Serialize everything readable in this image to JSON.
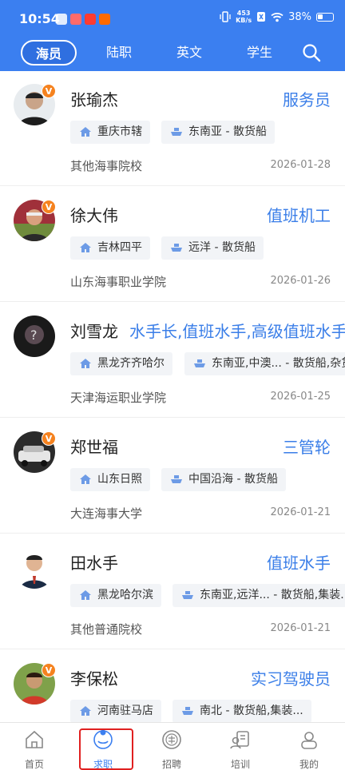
{
  "status_bar": {
    "time": "10:54",
    "net_speed_value": "453",
    "net_speed_unit": "KB/s",
    "battery": "38%"
  },
  "tabs": [
    {
      "label": "海员",
      "active": true
    },
    {
      "label": "陆职",
      "active": false
    },
    {
      "label": "英文",
      "active": false
    },
    {
      "label": "学生",
      "active": false
    }
  ],
  "colors": {
    "header": "#3b7ff0",
    "accent": "#3a7ee8",
    "badge": "#f5821f",
    "highlight_box": "#e02020"
  },
  "candidates": [
    {
      "name": "张瑜杰",
      "position": "服务员",
      "location": "重庆市辖",
      "route": "东南亚 - 散货船",
      "school": "其他海事院校",
      "date": "2026-01-28",
      "verified_badge": "V"
    },
    {
      "name": "徐大伟",
      "position": "值班机工",
      "location": "吉林四平",
      "route": "远洋 - 散货船",
      "school": "山东海事职业学院",
      "date": "2026-01-26",
      "verified_badge": "V"
    },
    {
      "name": "刘雪龙",
      "position": "水手长,值班水手,高级值班水手",
      "location": "黑龙齐齐哈尔",
      "route": "东南亚,中澳... - 散货船,杂货船",
      "school": "天津海运职业学院",
      "date": "2026-01-25",
      "verified_badge": ""
    },
    {
      "name": "郑世福",
      "position": "三管轮",
      "location": "山东日照",
      "route": "中国沿海 - 散货船",
      "school": "大连海事大学",
      "date": "2026-01-21",
      "verified_badge": "V"
    },
    {
      "name": "田水手",
      "position": "值班水手",
      "location": "黑龙哈尔滨",
      "route": "东南亚,远洋... - 散货船,集装...",
      "school": "其他普通院校",
      "date": "2026-01-21",
      "verified_badge": ""
    },
    {
      "name": "李保松",
      "position": "实习驾驶员",
      "location": "河南驻马店",
      "route": "南北 - 散货船,集装...",
      "school": "",
      "date": "",
      "verified_badge": "V"
    }
  ],
  "bottom_nav": [
    {
      "label": "首页",
      "icon": "home-icon",
      "active": false
    },
    {
      "label": "求职",
      "icon": "job-seeker-icon",
      "active": true
    },
    {
      "label": "招聘",
      "icon": "recruit-icon",
      "active": false
    },
    {
      "label": "培训",
      "icon": "training-icon",
      "active": false
    },
    {
      "label": "我的",
      "icon": "profile-icon",
      "active": false
    }
  ]
}
